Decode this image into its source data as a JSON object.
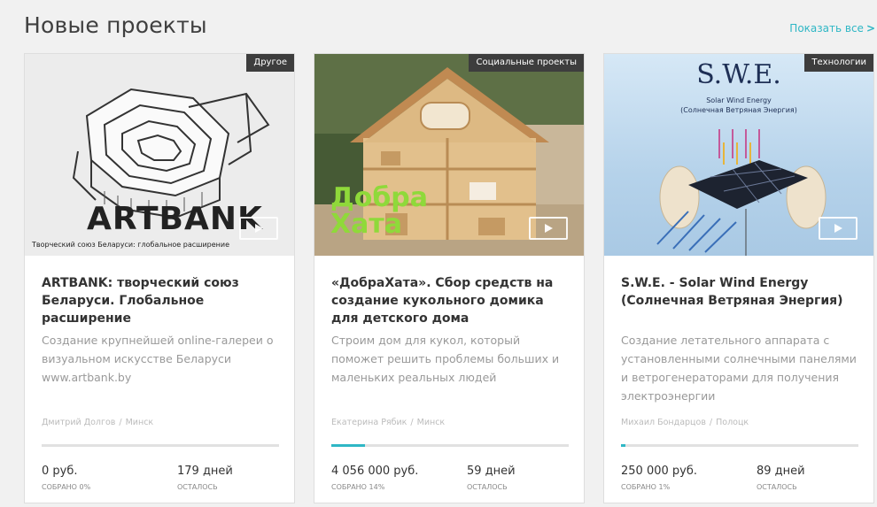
{
  "section": {
    "title": "Новые проекты",
    "show_all": "Показать все",
    "show_all_chevron": ">"
  },
  "projects": [
    {
      "category": "Другое",
      "title": "ARTBANK: творческий союз Беларуси. Глобальное расширение",
      "description": "Создание крупнейшей online-галереи о визуальном искусстве Беларуси www.artbank.by",
      "author": "Дмитрий Долгов",
      "city": "Минск",
      "progress": 0.0,
      "amount": "0 руб.",
      "collected_label": "СОБРАНО 0%",
      "days": "179 дней",
      "days_label": "ОСТАЛОСЬ",
      "image_text": {
        "logo": "ARTBANK",
        "subtitle": "Творческий союз Беларуси: глобальное расширение"
      }
    },
    {
      "category": "Социальные проекты",
      "title": "«ДобраХата». Сбор средств на создание кукольного домика для детского дома",
      "description": "Строим дом для кукол, который поможет решить проблемы больших и маленьких реальных людей",
      "author": "Екатерина Рябик",
      "city": "Минск",
      "progress": 0.14,
      "amount": "4 056 000 руб.",
      "collected_label": "СОБРАНО 14%",
      "days": "59 дней",
      "days_label": "ОСТАЛОСЬ",
      "image_text": {
        "logo_line1": "Добра",
        "logo_line2": "Хата"
      }
    },
    {
      "category": "Технологии",
      "title": "S.W.E. - Solar Wind Energy (Солнечная Ветряная Энергия)",
      "description": "Создание летательного аппарата с установленными солнечными панелями и ветрогенераторами для получения электроэнергии",
      "author": "Михаил Бондарцов",
      "city": "Полоцк",
      "progress": 0.01,
      "amount": "250 000 руб.",
      "collected_label": "СОБРАНО 1%",
      "days": "89 дней",
      "days_label": "ОСТАЛОСЬ",
      "image_text": {
        "heading": "S.W.E.",
        "sub1": "Solar Wind Energy",
        "sub2": "(Солнечная Ветряная Энергия)"
      }
    }
  ],
  "colors": {
    "accent": "#2fb7c5",
    "badge_bg": "#3d3d3d",
    "card_bg": "#ffffff",
    "page_bg": "#f1f1f1"
  },
  "icons": {
    "play": "play-icon"
  }
}
